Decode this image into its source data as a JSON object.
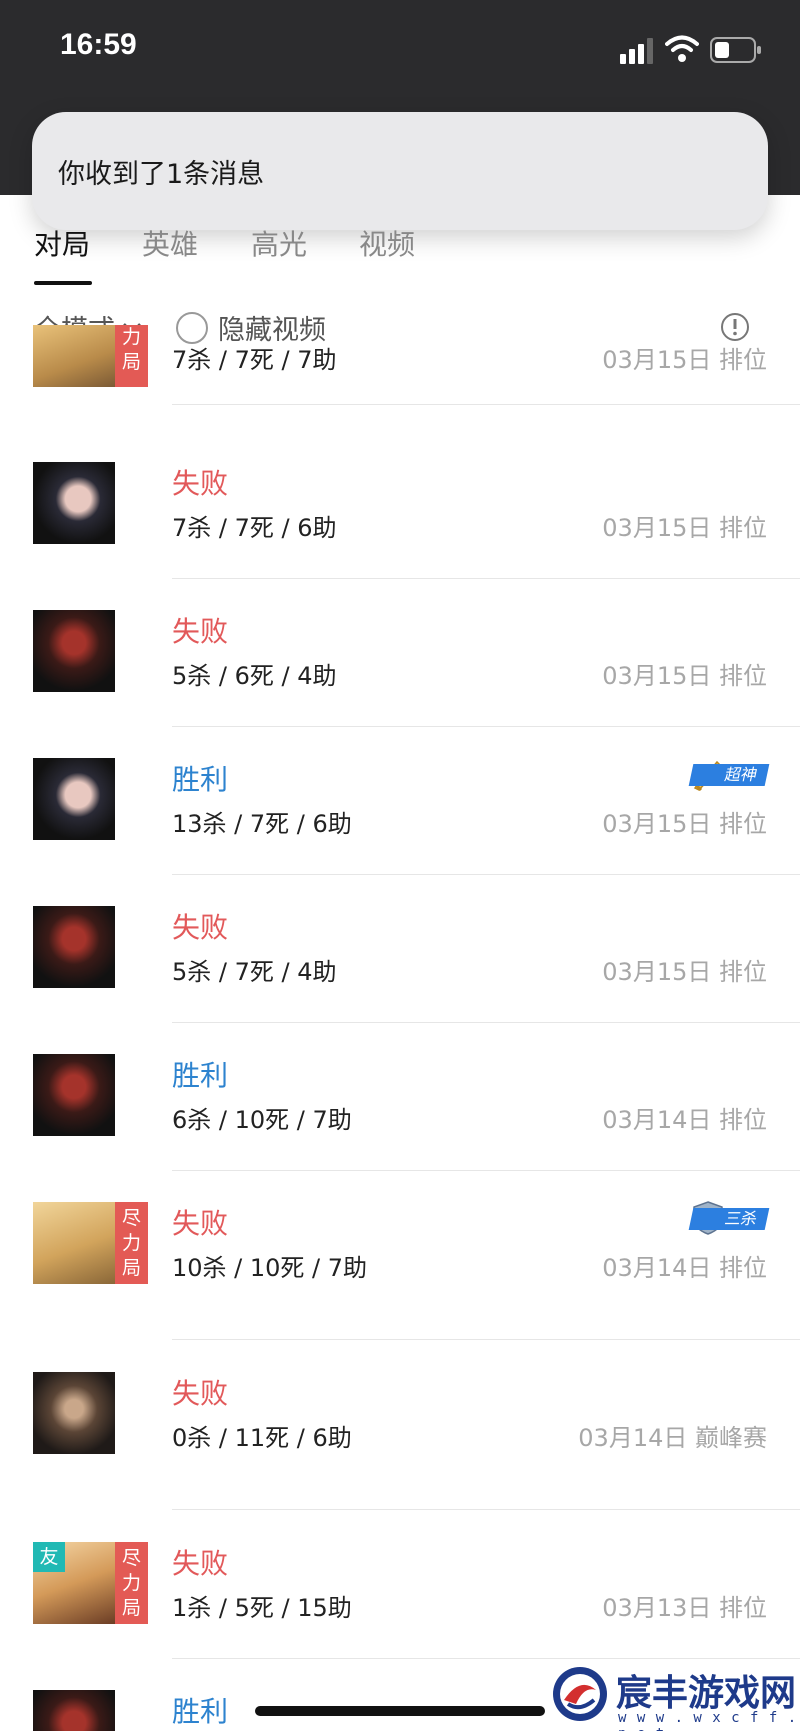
{
  "status": {
    "time": "16:59"
  },
  "notification": {
    "text": "你收到了1条消息"
  },
  "tabs": [
    {
      "label": "对局",
      "active": true
    },
    {
      "label": "英雄",
      "active": false
    },
    {
      "label": "高光",
      "active": false
    },
    {
      "label": "视频",
      "active": false
    }
  ],
  "filters": {
    "mode": "全模式",
    "hide_video": "隐藏视频"
  },
  "badges": {
    "jinli": [
      "尽",
      "力",
      "局"
    ],
    "you": "友"
  },
  "matches": [
    {
      "result": "",
      "kda": "7杀 / 7死 / 7助",
      "meta": "03月15日  排位"
    },
    {
      "result": "失败",
      "kda": "7杀 / 7死 / 6助",
      "meta": "03月15日  排位"
    },
    {
      "result": "失败",
      "kda": "5杀 / 6死 / 4助",
      "meta": "03月15日  排位"
    },
    {
      "result": "胜利",
      "kda": "13杀 / 7死 / 6助",
      "meta": "03月15日  排位",
      "honor": "超神"
    },
    {
      "result": "失败",
      "kda": "5杀 / 7死 / 4助",
      "meta": "03月15日  排位"
    },
    {
      "result": "胜利",
      "kda": "6杀 / 10死 / 7助",
      "meta": "03月14日  排位"
    },
    {
      "result": "失败",
      "kda": "10杀 / 10死 / 7助",
      "meta": "03月14日  排位",
      "honor": "三杀"
    },
    {
      "result": "失败",
      "kda": "0杀 / 11死 / 6助",
      "meta": "03月14日  巅峰赛"
    },
    {
      "result": "失败",
      "kda": "1杀 / 5死 / 15助",
      "meta": "03月13日  排位"
    },
    {
      "result": "胜利",
      "kda": "",
      "meta": ""
    }
  ],
  "watermark": {
    "name": "宸丰游戏网",
    "url": "w w w . w x c f f . n e t"
  },
  "colors": {
    "lose": "#e2595a",
    "win": "#2d83cf",
    "statusbar": "#2b2b2d"
  }
}
